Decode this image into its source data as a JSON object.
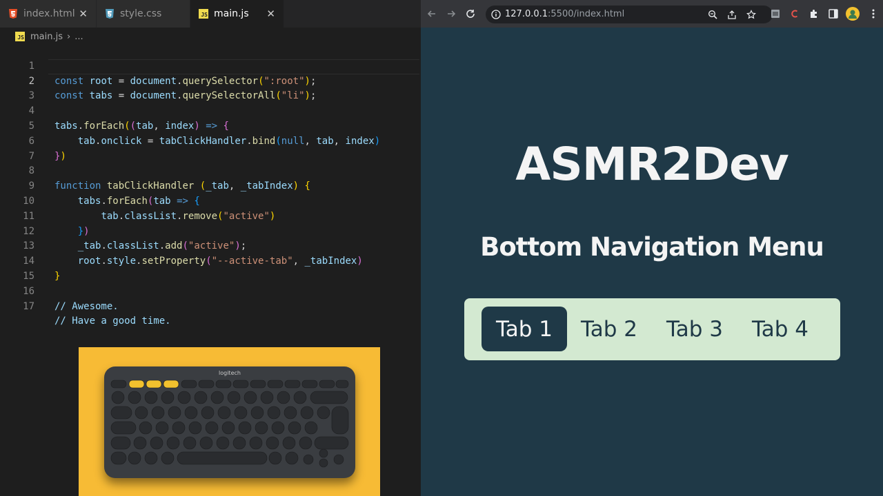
{
  "editor": {
    "tabs": [
      {
        "name": "index.html",
        "icon": "html5-icon"
      },
      {
        "name": "style.css",
        "icon": "css3-icon"
      },
      {
        "name": "main.js",
        "icon": "javascript-icon",
        "active": true
      }
    ],
    "breadcrumb": {
      "file": "main.js",
      "separator": "›",
      "more": "..."
    },
    "lines": [
      {
        "n": "1"
      },
      {
        "n": "2"
      },
      {
        "n": "3"
      },
      {
        "n": "4"
      },
      {
        "n": "5"
      },
      {
        "n": "6"
      },
      {
        "n": "7"
      },
      {
        "n": "8"
      },
      {
        "n": "9"
      },
      {
        "n": "10"
      },
      {
        "n": "11"
      },
      {
        "n": "12"
      },
      {
        "n": "13"
      },
      {
        "n": "14"
      },
      {
        "n": "15"
      },
      {
        "n": "16"
      },
      {
        "n": "17"
      }
    ],
    "code": {
      "l1": {
        "kw": "const",
        "var": "root",
        "op": " = ",
        "obj": "document",
        "fn": "querySelector",
        "str": "\":root\""
      },
      "l2": {
        "kw": "const",
        "var": "tabs",
        "op": " = ",
        "obj": "document",
        "fn": "querySelectorAll",
        "str": "\"li\""
      },
      "l4": {
        "obj": "tabs",
        "fn": "forEach",
        "p1": "tab",
        "p2": "index",
        "arrow": "=>"
      },
      "l5": {
        "obj": "tab",
        "prop": "onclick",
        "fn1": "tabClickHandler",
        "fn2": "bind",
        "a1": "null",
        "a2": "tab",
        "a3": "index"
      },
      "l8": {
        "kw": "function",
        "fn": "tabClickHandler",
        "p1": "_tab",
        "p2": "_tabIndex"
      },
      "l9": {
        "obj": "tabs",
        "fn": "forEach",
        "p1": "tab",
        "arrow": "=>"
      },
      "l10": {
        "obj": "tab",
        "prop": "classList",
        "fn": "remove",
        "str": "\"active\""
      },
      "l12": {
        "obj": "_tab",
        "prop": "classList",
        "fn": "add",
        "str": "\"active\""
      },
      "l13": {
        "obj": "root",
        "prop": "style",
        "fn": "setProperty",
        "str": "\"--active-tab\"",
        "arg": "_tabIndex"
      },
      "l16": "// Awesome.",
      "l17": "// Have a good time."
    }
  },
  "keyboard": {
    "brand": "logitech"
  },
  "browser": {
    "url_host": "127.0.0.1",
    "url_path": ":5500/index.html",
    "page_title": "ASMR2Dev",
    "page_subtitle": "Bottom Navigation Menu",
    "nav_tabs": [
      {
        "label": "Tab 1",
        "active": true
      },
      {
        "label": "Tab 2",
        "active": false
      },
      {
        "label": "Tab 3",
        "active": false
      },
      {
        "label": "Tab 4",
        "active": false
      }
    ]
  },
  "colors": {
    "page_bg": "#1f3947",
    "nav_bg": "#d3e9d1",
    "active_tab_bg": "#1f3947",
    "editor_bg": "#1e1e1e",
    "photo_bg": "#f7bb35"
  }
}
